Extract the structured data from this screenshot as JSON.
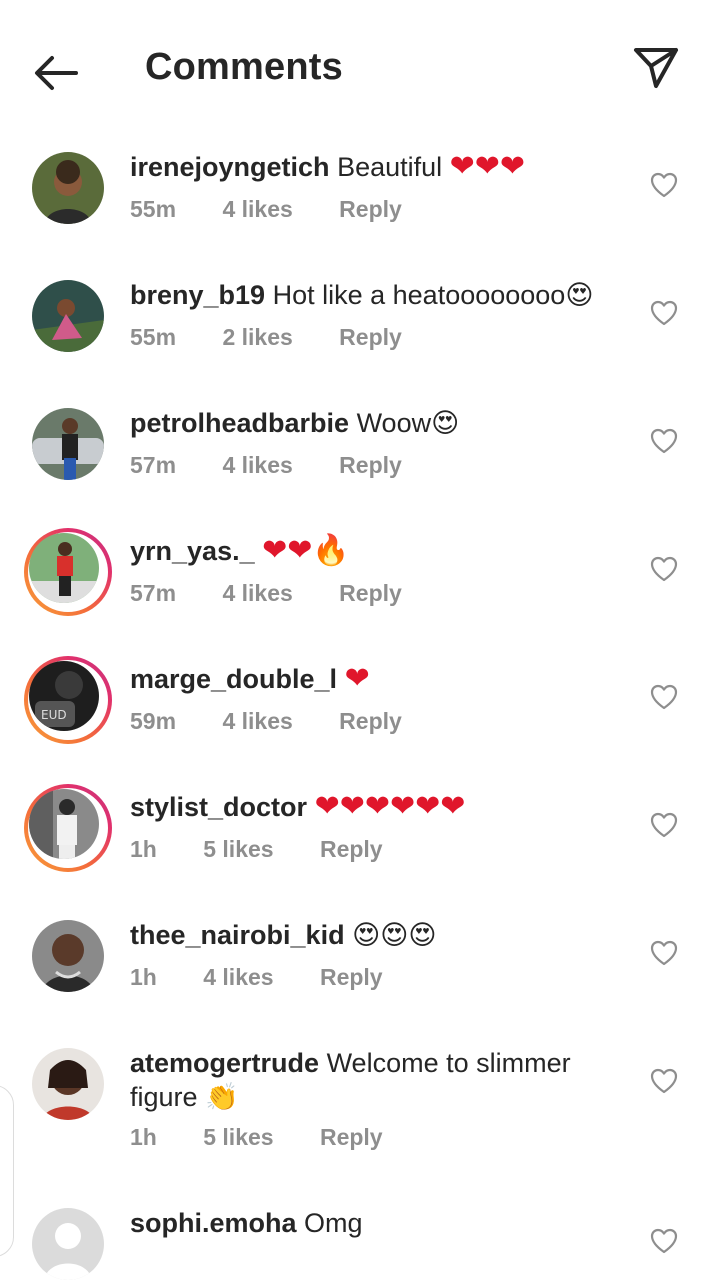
{
  "header": {
    "title": "Comments"
  },
  "comments": [
    {
      "username": "irenejoyngetich",
      "text": "Beautiful",
      "emoji": "❤❤❤",
      "time": "55m",
      "likes": "4 likes",
      "reply": "Reply"
    },
    {
      "username": "breny_b19",
      "text": "Hot like a heatoooooooo",
      "emoji": "😍",
      "time": "55m",
      "likes": "2 likes",
      "reply": "Reply"
    },
    {
      "username": "petrolheadbarbie",
      "text": "Woow",
      "emoji": "😍",
      "time": "57m",
      "likes": "4 likes",
      "reply": "Reply"
    },
    {
      "username": "yrn_yas._",
      "text": "",
      "emoji": "❤❤🔥",
      "time": "57m",
      "likes": "4 likes",
      "reply": "Reply"
    },
    {
      "username": "marge_double_l",
      "text": "",
      "emoji": "❤",
      "time": "59m",
      "likes": "4 likes",
      "reply": "Reply"
    },
    {
      "username": "stylist_doctor",
      "text": "",
      "emoji": "❤❤❤❤❤❤",
      "time": "1h",
      "likes": "5 likes",
      "reply": "Reply"
    },
    {
      "username": "thee_nairobi_kid",
      "text": "",
      "emoji": "😍😍😍",
      "time": "1h",
      "likes": "4 likes",
      "reply": "Reply"
    },
    {
      "username": "atemogertrude",
      "text": "Welcome to slimmer figure",
      "emoji": "👏",
      "time": "1h",
      "likes": "5 likes",
      "reply": "Reply"
    },
    {
      "username": "sophi.emoha",
      "text": "Omg",
      "emoji": "",
      "time": "",
      "likes": "",
      "reply": ""
    }
  ],
  "icons": {
    "back": "arrow-left-icon",
    "share": "paper-plane-icon",
    "like": "heart-outline-icon"
  },
  "colors": {
    "text": "#262626",
    "meta": "#8e8e8e",
    "heart": "#e0162b",
    "story_ring_start": "#f9a13a",
    "story_ring_end": "#c13584"
  }
}
